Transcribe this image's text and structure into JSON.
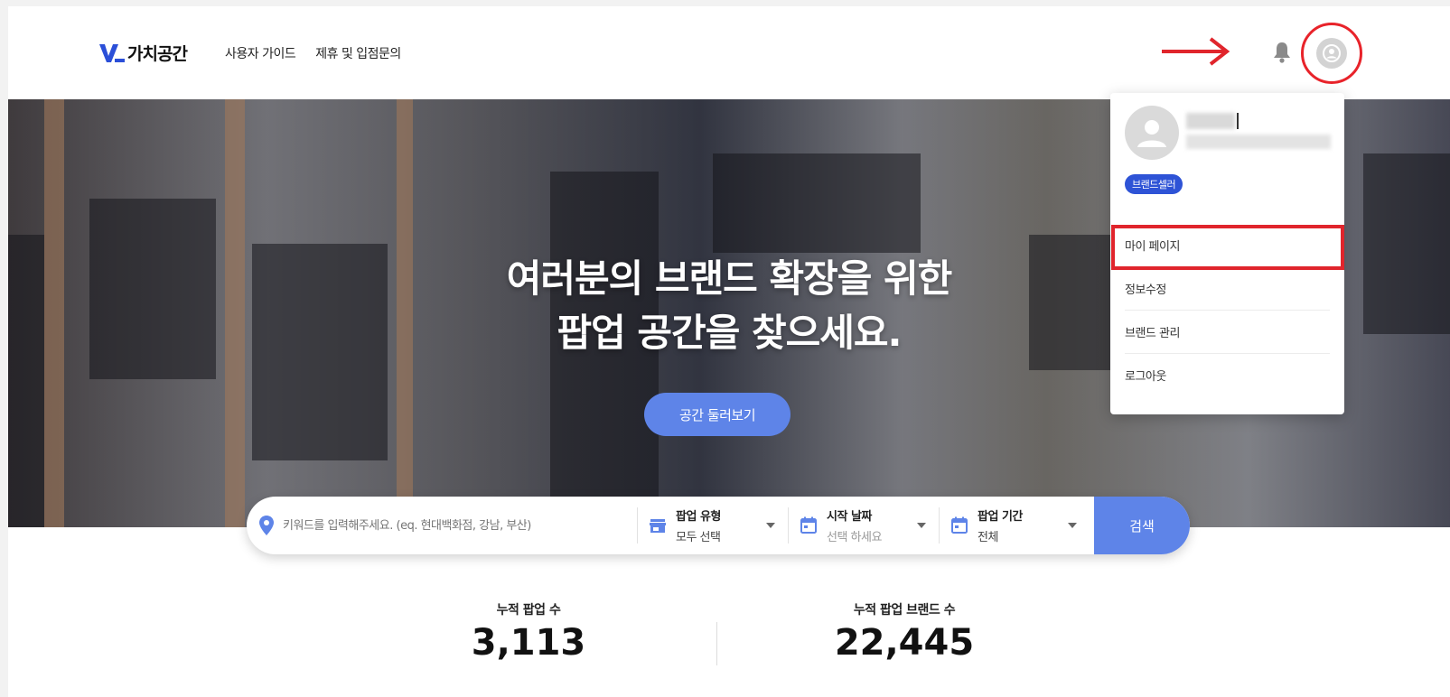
{
  "header": {
    "logo_text": "가치공간",
    "nav": [
      "사용자 가이드",
      "제휴 및 입점문의"
    ]
  },
  "hero": {
    "title_line1": "여러분의 브랜드 확장을 위한",
    "title_line2": "팝업 공간을 찾으세요.",
    "button": "공간 둘러보기"
  },
  "search": {
    "placeholder": "키워드를 입력해주세요. (eq. 현대백화점, 강남, 부산)",
    "filters": [
      {
        "label": "팝업 유형",
        "value": "모두 선택",
        "icon": "store-icon"
      },
      {
        "label": "시작 날짜",
        "value": "선택 하세요",
        "icon": "calendar-icon"
      },
      {
        "label": "팝업 기간",
        "value": "전체",
        "icon": "calendar-icon"
      }
    ],
    "button": "검색"
  },
  "stats": [
    {
      "label": "누적 팝업 수",
      "value": "3,113"
    },
    {
      "label": "누적 팝업 브랜드 수",
      "value": "22,445"
    }
  ],
  "dropdown": {
    "badge": "브랜드셀러",
    "menu": [
      "마이 페이지",
      "정보수정",
      "브랜드 관리",
      "로그아웃"
    ]
  },
  "colors": {
    "accent": "#5e84e8",
    "badge": "#2e53d6",
    "annotation": "#e0252c"
  }
}
